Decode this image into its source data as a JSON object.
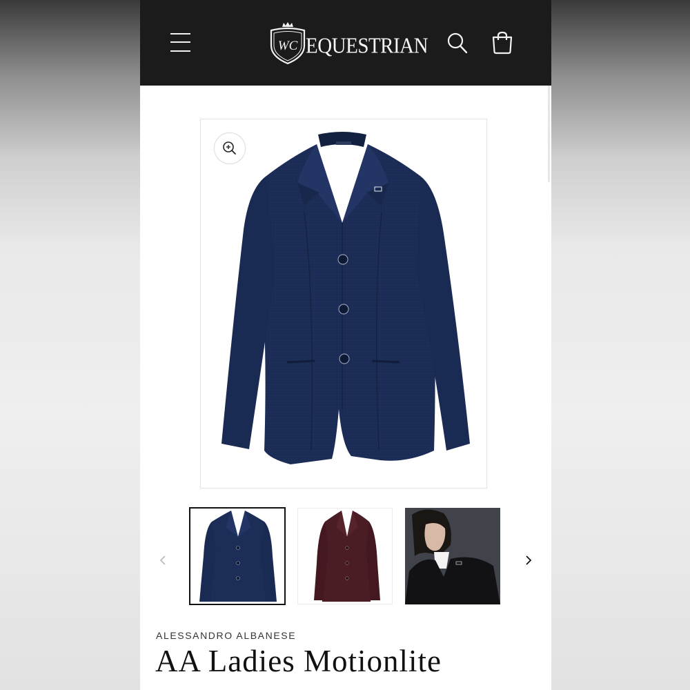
{
  "header": {
    "logo_monogram": "WC",
    "logo_text": "EQUESTRIAN",
    "menu_icon": "hamburger-menu-icon",
    "search_icon": "search-icon",
    "cart_icon": "shopping-bag-icon",
    "background": "#1b1b1b"
  },
  "gallery": {
    "zoom_icon": "zoom-in-icon",
    "main_image": "navy-show-jacket",
    "thumbnails": [
      {
        "image": "navy-show-jacket",
        "selected": true
      },
      {
        "image": "burgundy-show-jacket",
        "selected": false
      },
      {
        "image": "model-wearing-black-show-jacket",
        "selected": false
      }
    ],
    "prev_icon": "chevron-left-icon",
    "next_icon": "chevron-right-icon"
  },
  "product": {
    "brand": "ALESSANDRO ALBANESE",
    "title": "AA Ladies Motionlite"
  },
  "colors": {
    "navy": "#1b2d55",
    "burgundy": "#4a1c24",
    "black": "#111111"
  }
}
